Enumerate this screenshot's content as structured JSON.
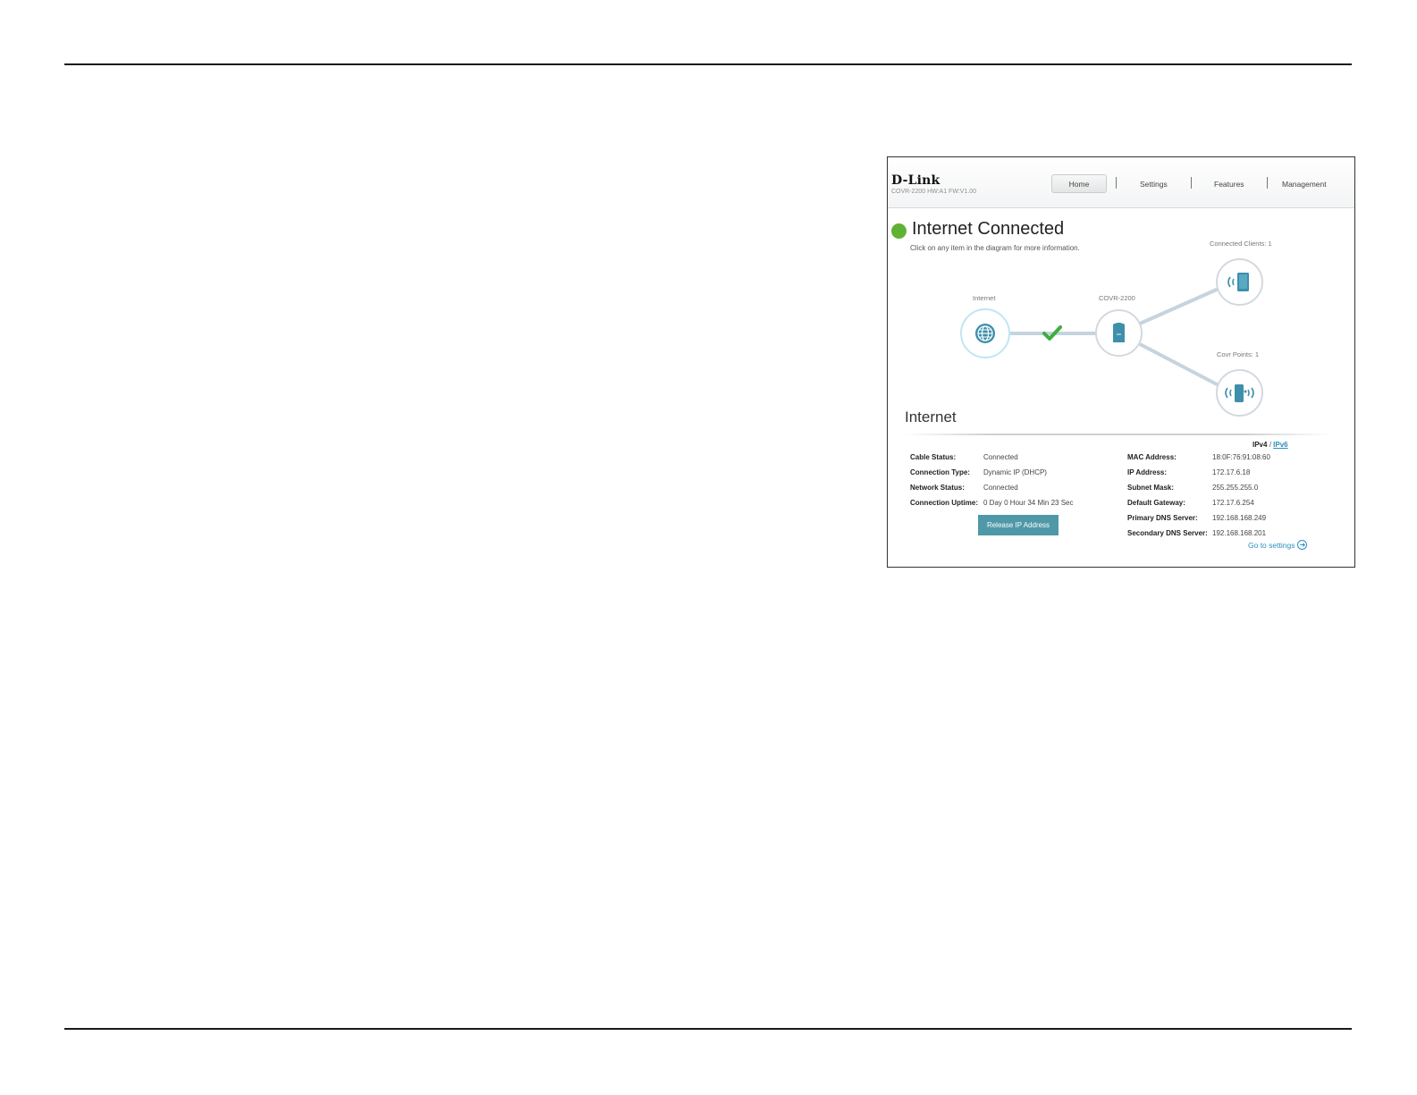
{
  "router_ui": {
    "brand": "D-Link",
    "firmware": "COVR-2200 HW:A1 FW:V1.00",
    "nav": {
      "home": "Home",
      "settings": "Settings",
      "features": "Features",
      "management": "Management"
    },
    "status_title": "Internet Connected",
    "status_subtitle": "Click on any item in the diagram for more information.",
    "diagram": {
      "internet_label": "Internet",
      "covr_label": "COVR-2200",
      "clients_label": "Connected Clients: 1",
      "points_label": "Covr Points: 1"
    },
    "section_title": "Internet",
    "ipv4": "IPv4",
    "ip_sep": "/",
    "ipv6": "IPv6",
    "left_details": [
      {
        "key": "Cable Status:",
        "value": "Connected"
      },
      {
        "key": "Connection Type:",
        "value": "Dynamic IP (DHCP)"
      },
      {
        "key": "Network Status:",
        "value": "Connected"
      },
      {
        "key": "Connection Uptime:",
        "value": "0 Day 0 Hour 34 Min 23 Sec"
      }
    ],
    "right_details": [
      {
        "key": "MAC Address:",
        "value": "18:0F:76:91:08:60"
      },
      {
        "key": "IP Address:",
        "value": "172.17.6.18"
      },
      {
        "key": "Subnet Mask:",
        "value": "255.255.255.0"
      },
      {
        "key": "Default Gateway:",
        "value": "172.17.6.254"
      },
      {
        "key": "Primary DNS Server:",
        "value": "192.168.168.249"
      },
      {
        "key": "Secondary DNS Server:",
        "value": "192.168.168.201"
      }
    ],
    "release_button": "Release IP Address",
    "goto_settings": "Go to settings",
    "colors": {
      "accent": "#2c8fc0",
      "connected_green": "#5fb233",
      "button_teal": "#4f98a8",
      "device_blue": "#3e8fab"
    }
  }
}
